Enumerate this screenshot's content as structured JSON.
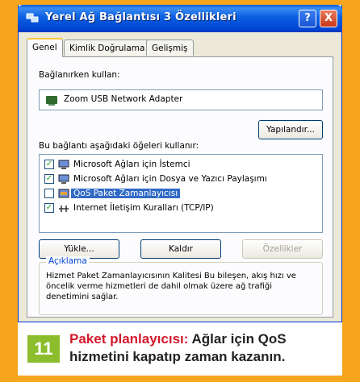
{
  "window": {
    "title": "Yerel Ağ Bağlantısı 3 Özellikleri",
    "help_label": "?",
    "close_label": "X"
  },
  "tabs": [
    {
      "label": "Genel",
      "active": true
    },
    {
      "label": "Kimlik Doğrulama",
      "active": false
    },
    {
      "label": "Gelişmiş",
      "active": false
    }
  ],
  "connect_using_label": "Bağlanırken kullan:",
  "adapter_name": "Zoom USB Network Adapter",
  "configure_button": "Yapılandır...",
  "items_label": "Bu bağlantı aşağıdaki öğeleri kullanır:",
  "items": [
    {
      "label": "Microsoft Ağları için İstemci",
      "checked": true,
      "selected": false
    },
    {
      "label": "Microsoft Ağları için Dosya ve Yazıcı Paylaşımı",
      "checked": true,
      "selected": false
    },
    {
      "label": "QoS Paket Zamanlayıcısı",
      "checked": false,
      "selected": true
    },
    {
      "label": "Internet İletişim Kuralları (TCP/IP)",
      "checked": true,
      "selected": false
    }
  ],
  "buttons": {
    "install": "Yükle...",
    "uninstall": "Kaldır",
    "properties": "Özellikler"
  },
  "description": {
    "title": "Açıklama",
    "text": "Hizmet Paket Zamanlayıcısının Kalitesi Bu bileşen, akış hızı ve öncelik verme hizmetleri de dahil olmak üzere ağ trafiği denetimini sağlar."
  },
  "caption": {
    "number": "11",
    "highlight": "Paket planlayıcısı:",
    "text": "Ağlar için QoS hizmetini kapatıp zaman kazanın."
  },
  "colors": {
    "frame": "#f6a51d",
    "titlebar": "#0b5fe0",
    "badge": "#8cbd2c",
    "highlight_text": "#d3192c",
    "selection": "#316ac5"
  }
}
